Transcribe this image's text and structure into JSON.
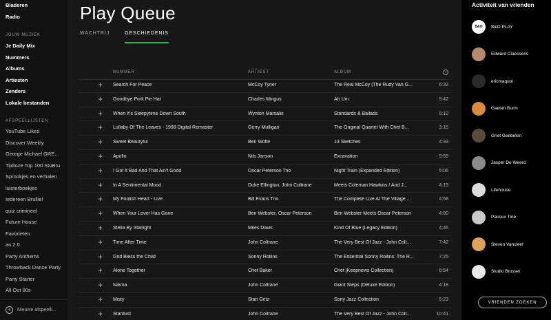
{
  "sidebar": {
    "top_items": [
      "Bladeren",
      "Radio"
    ],
    "music_heading": "JOUW MUZIEK",
    "music_items": [
      "Je Daily Mix",
      "Nummers",
      "Albums",
      "Artiesten",
      "Zenders",
      "Lokale bestanden"
    ],
    "playlists_heading": "AFSPEELLIJSTEN",
    "playlists": [
      "YouTube Likes",
      "Discover Weekly",
      "George Michael GRE...",
      "Tijdloze Top 100 StuBru",
      "Sprookjes en verhalen",
      "luisterboekjes",
      "Iedereen Brullie!",
      "quiz crimineel",
      "Future House",
      "Favorieten",
      "an 2.0",
      "Party Anthems",
      "Throwback Dance Party",
      "Party Starter",
      "All Out 90s"
    ],
    "new_playlist": "Nieuwe afspeelli..."
  },
  "main": {
    "title": "Play Queue",
    "tabs": [
      {
        "label": "WACHTRIJ",
        "active": false
      },
      {
        "label": "GESCHIEDENIS",
        "active": true
      }
    ],
    "columns": {
      "name": "NUMMER",
      "artist": "ARTIEST",
      "album": "ALBUM"
    },
    "rows": [
      {
        "name": "Search For Peace",
        "artist": "McCoy Tyner",
        "album": "The Real McCoy (The Rudy Van G...",
        "time": "6:32"
      },
      {
        "name": "Goodbye Pork Pie Hat",
        "artist": "Charles Mingus",
        "album": "Ah Um",
        "time": "5:42"
      },
      {
        "name": "When It's Sleepytime Down South",
        "artist": "Wynton Marsalis",
        "album": "Standards & Ballads",
        "time": "5:10"
      },
      {
        "name": "Lullaby Of The Leaves - 1998 Digital Remaster",
        "artist": "Gerry Mulligan",
        "album": "The Original Quartet With Chet B...",
        "time": "3:15"
      },
      {
        "name": "Sweet Beautyful",
        "artist": "Ben Wolfe",
        "album": "13 Sketches",
        "time": "4:33"
      },
      {
        "name": "Apollo",
        "artist": "Nils Janson",
        "album": "Excavation",
        "time": "5:59"
      },
      {
        "name": "I Got It Bad And That Ain't Good",
        "artist": "Oscar Peterson Trio",
        "album": "Night Train (Expanded Edition)",
        "time": "5:06"
      },
      {
        "name": "In A Sentimental Mood",
        "artist": "Duke Ellington, John Coltrane",
        "album": "Meets Coleman Hawkins / And J...",
        "time": "4:15"
      },
      {
        "name": "My Foolish Heart - Live",
        "artist": "Bill Evans Trio",
        "album": "The Complete Live At The Village ...",
        "time": "4:58"
      },
      {
        "name": "When Your Lover Has Gone",
        "artist": "Ben Webster, Oscar Peterson",
        "album": "Ben Webster Meets Oscar Peterson",
        "time": "4:00"
      },
      {
        "name": "Stella By Starlight",
        "artist": "Miles Davis",
        "album": "Kind Of Blue (Legacy Edition)",
        "time": "4:45"
      },
      {
        "name": "Time After Time",
        "artist": "John Coltrane",
        "album": "The Very Best Of Jazz - John Colt...",
        "time": "7:42"
      },
      {
        "name": "God Bless the Child",
        "artist": "Sonny Rollins",
        "album": "The Essential Sonny Rollins: The R...",
        "time": "7:25"
      },
      {
        "name": "Alone Together",
        "artist": "Chet Baker",
        "album": "Chet [Keepnews Collection]",
        "time": "6:54"
      },
      {
        "name": "Naima",
        "artist": "John Coltrane",
        "album": "Giant Steps (Deluxe Edition)",
        "time": "4:18"
      },
      {
        "name": "Misty",
        "artist": "Stan Getz",
        "album": "Sony Jazz Collection",
        "time": "5:23"
      },
      {
        "name": "Stardust",
        "artist": "John Coltrane",
        "album": "The Very Best Of Jazz - John Colt...",
        "time": "10:41"
      }
    ]
  },
  "friends": {
    "title": "Activiteit van vrienden",
    "list": [
      {
        "name": "B&O PLAY",
        "color": "#ffffff",
        "initials": "B&O"
      },
      {
        "name": "Edward Claessens",
        "color": "#b78a6e",
        "initials": ""
      },
      {
        "name": "ericmaquoi",
        "color": "#2a2a2a",
        "initials": ""
      },
      {
        "name": "Gaetan Burm",
        "color": "#d98a3c",
        "initials": ""
      },
      {
        "name": "Griet Geebelen",
        "color": "#5a4a3a",
        "initials": ""
      },
      {
        "name": "Jasper De Weerd",
        "color": "#8a8a8a",
        "initials": ""
      },
      {
        "name": "Lifehouse",
        "color": "#dcdcdc",
        "initials": ""
      },
      {
        "name": "Pairoux Tine",
        "color": "#c8c8c8",
        "initials": ""
      },
      {
        "name": "Steven Vancleef",
        "color": "#e0a05a",
        "initials": ""
      },
      {
        "name": "Studio Brussel",
        "color": "#e8e8e8",
        "initials": ""
      }
    ],
    "find_button": "VRIENDEN ZOEKEN"
  }
}
